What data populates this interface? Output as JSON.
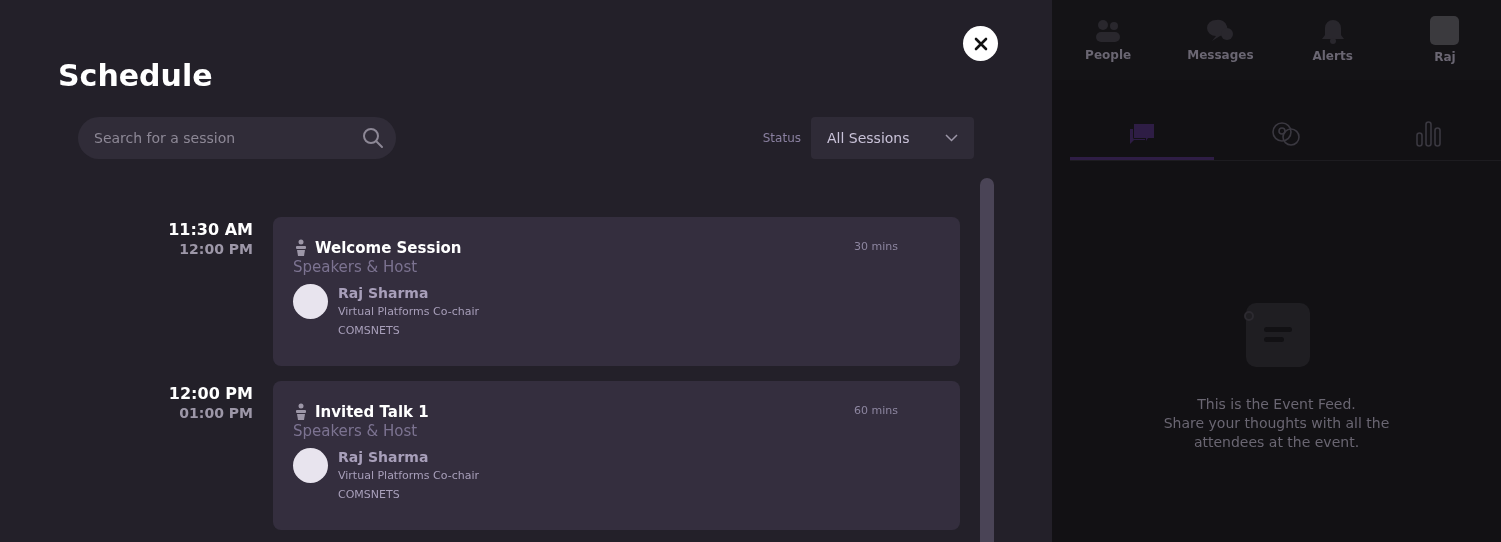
{
  "schedule": {
    "title": "Schedule",
    "search": {
      "placeholder": "Search for a session"
    },
    "status_filter": {
      "label": "Status",
      "value": "All Sessions"
    },
    "sessions": [
      {
        "start": "11:30 AM",
        "end": "12:00 PM",
        "title": "Welcome Session",
        "category": "Speakers & Host",
        "duration": "30 mins",
        "speakers": [
          {
            "name": "Raj Sharma",
            "role": "Virtual Platforms Co-chair",
            "org": "COMSNETS"
          }
        ]
      },
      {
        "start": "12:00 PM",
        "end": "01:00 PM",
        "title": "Invited Talk 1",
        "category": "Speakers & Host",
        "duration": "60 mins",
        "speakers": [
          {
            "name": "Raj Sharma",
            "role": "Virtual Platforms Co-chair",
            "org": "COMSNETS"
          }
        ]
      }
    ]
  },
  "top_nav": [
    {
      "kind": "people",
      "label": "People"
    },
    {
      "kind": "messages",
      "label": "Messages"
    },
    {
      "kind": "alerts",
      "label": "Alerts"
    },
    {
      "kind": "profile",
      "label": "Raj"
    }
  ],
  "feed_tabs": [
    {
      "kind": "chat",
      "selected": true
    },
    {
      "kind": "qa",
      "selected": false
    },
    {
      "kind": "polls",
      "selected": false
    }
  ],
  "event_feed": {
    "message": "This is the Event Feed.\nShare your thoughts with all the attendees at the event."
  }
}
